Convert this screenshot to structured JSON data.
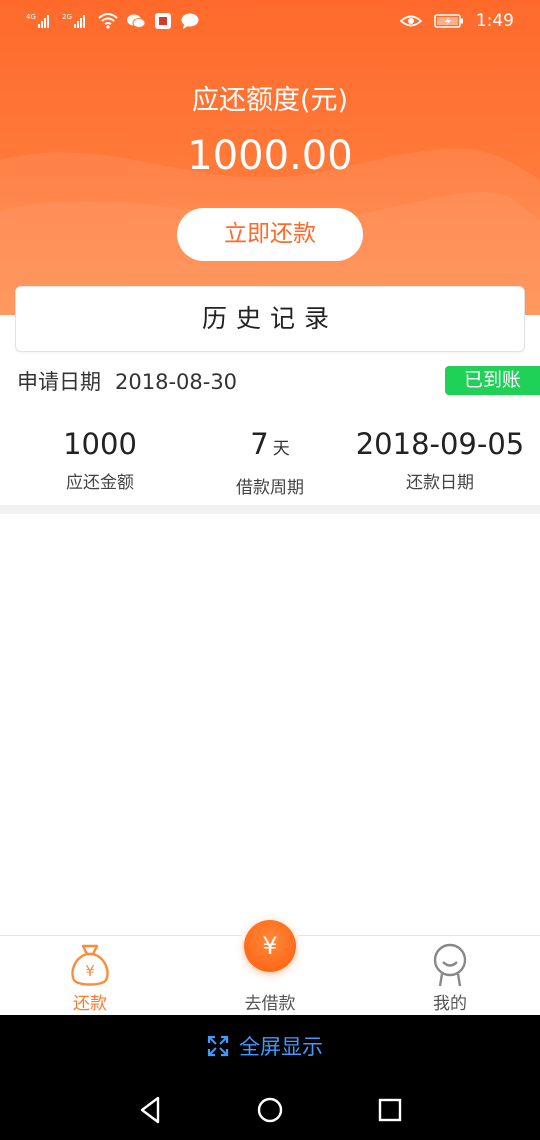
{
  "status_bar": {
    "time": "1:49",
    "signal1_label": "4G",
    "signal2_label": "2G",
    "icons": [
      "signal-icon",
      "signal-icon",
      "wifi-icon",
      "wechat-icon",
      "app-notification-icon",
      "message-icon",
      "eye-icon",
      "battery-icon"
    ]
  },
  "header": {
    "due_label": "应还额度(元)",
    "due_amount": "1000.00",
    "repay_button": "立即还款"
  },
  "history": {
    "title": "历史记录"
  },
  "record": {
    "apply_label": "申请日期",
    "apply_date": "2018-08-30",
    "status": "已到账",
    "amount_value": "1000",
    "amount_label": "应还金额",
    "period_value": "7",
    "period_unit": "天",
    "period_label": "借款周期",
    "repay_date_value": "2018-09-05",
    "repay_date_label": "还款日期"
  },
  "bottom_nav": {
    "items": [
      {
        "label": "还款",
        "icon": "money-bag-icon",
        "active": true
      },
      {
        "label": "去借款",
        "icon": "yuan-icon",
        "active": false
      },
      {
        "label": "我的",
        "icon": "person-icon",
        "active": false
      }
    ],
    "fab_symbol": "¥"
  },
  "fullscreen": {
    "label": "全屏显示",
    "icon": "expand-icon"
  },
  "colors": {
    "brand": "#ff6a2b",
    "status_green": "#1fd257",
    "link_blue": "#3f9bff"
  }
}
